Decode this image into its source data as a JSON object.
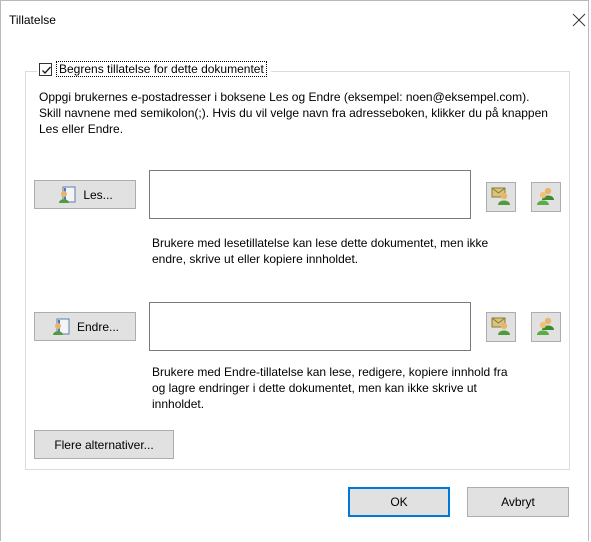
{
  "window": {
    "title": "Tillatelse"
  },
  "restrict": {
    "checked": true,
    "label": "Begrens tillatelse for dette dokumentet"
  },
  "instructions": "Oppgi brukernes e-postadresser i boksene Les og Endre (eksempel: noen@eksempel.com). Skill navnene med semikolon(;). Hvis du vil velge navn fra adresseboken, klikker du på knappen Les eller Endre.",
  "read": {
    "button_label": "Les...",
    "value": "",
    "description": "Brukere med lesetillatelse kan lese dette dokumentet, men ikke endre, skrive ut eller kopiere innholdet."
  },
  "change": {
    "button_label": "Endre...",
    "value": "",
    "description": "Brukere med Endre-tillatelse kan lese, redigere, kopiere innhold fra og lagre endringer i dette dokumentet, men kan ikke skrive ut innholdet."
  },
  "more_options_label": "Flere alternativer...",
  "footer": {
    "ok_label": "OK",
    "cancel_label": "Avbryt"
  },
  "icons": {
    "address_book": "address-book-icon",
    "email_user": "email-user-icon",
    "users": "users-icon",
    "close": "close-icon",
    "check": "checkmark-icon"
  }
}
